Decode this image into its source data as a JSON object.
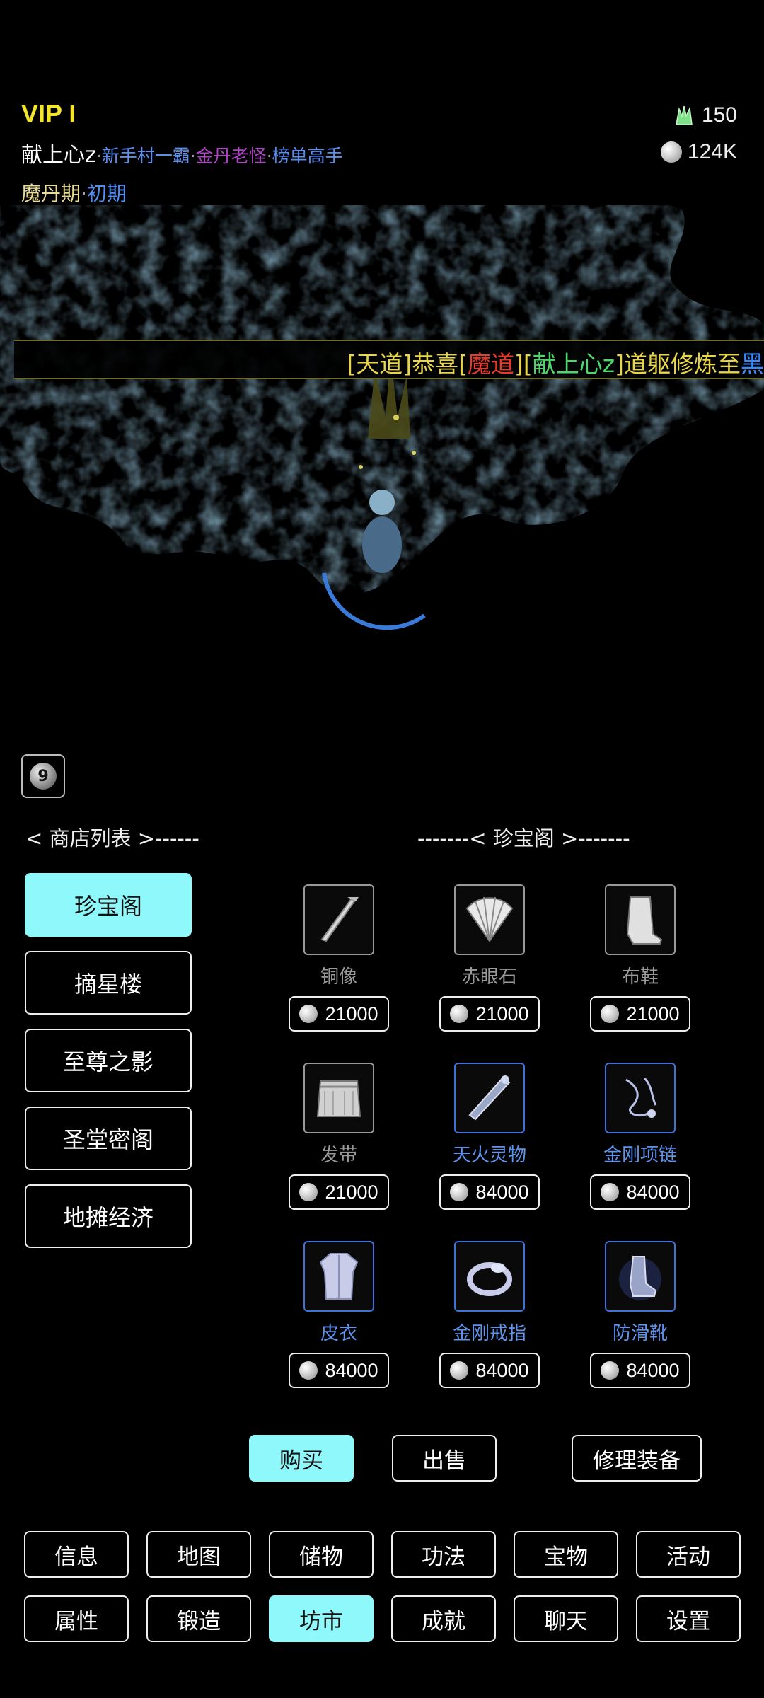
{
  "header": {
    "vip": "VIP I",
    "player_name": "献上心z",
    "titles": [
      "新手村一霸",
      "金丹老怪",
      "榜单高手"
    ],
    "title_separator": "·",
    "realm": "魔丹期",
    "stage": "初期",
    "jade": "150",
    "silver": "124K"
  },
  "ticker": {
    "part1": "[",
    "tag_tian": "天道",
    "part2": "]恭喜[",
    "tag_mo": "魔道",
    "part3": "][",
    "tag_name": "献上心z",
    "part4": "]道躯修炼至",
    "part5": "黑"
  },
  "level_badge": "9",
  "shop_list_title": "< 商店列表 >------",
  "shop_title": "-------< 珍宝阁 >-------",
  "shops": [
    {
      "label": "珍宝阁",
      "active": true
    },
    {
      "label": "摘星楼",
      "active": false
    },
    {
      "label": "至尊之影",
      "active": false
    },
    {
      "label": "圣堂密阁",
      "active": false
    },
    {
      "label": "地摊经济",
      "active": false
    }
  ],
  "items": [
    {
      "name": "铜像",
      "price": "21000",
      "rarity": "common",
      "icon": "scroll-icon"
    },
    {
      "name": "赤眼石",
      "price": "21000",
      "rarity": "common",
      "icon": "fan-icon"
    },
    {
      "name": "布鞋",
      "price": "21000",
      "rarity": "common",
      "icon": "boot-icon"
    },
    {
      "name": "发带",
      "price": "21000",
      "rarity": "common",
      "icon": "headband-icon"
    },
    {
      "name": "天火灵物",
      "price": "84000",
      "rarity": "rare",
      "icon": "rod-icon"
    },
    {
      "name": "金刚项链",
      "price": "84000",
      "rarity": "rare",
      "icon": "necklace-icon"
    },
    {
      "name": "皮衣",
      "price": "84000",
      "rarity": "rare",
      "icon": "armor-icon"
    },
    {
      "name": "金刚戒指",
      "price": "84000",
      "rarity": "rare",
      "icon": "ring-icon"
    },
    {
      "name": "防滑靴",
      "price": "84000",
      "rarity": "rare",
      "icon": "rare-boot-icon"
    }
  ],
  "actions": {
    "buy": "购买",
    "sell": "出售",
    "repair": "修理装备"
  },
  "nav_row1": [
    "信息",
    "地图",
    "储物",
    "功法",
    "宝物",
    "活动"
  ],
  "nav_row2": [
    "属性",
    "锻造",
    "坊市",
    "成就",
    "聊天",
    "设置"
  ],
  "nav_active": "坊市",
  "colors": {
    "accent": "#8ef8fb",
    "vip": "#f3e62a",
    "rare_item": "#5e94ee",
    "common_item": "#9a9a9a"
  }
}
